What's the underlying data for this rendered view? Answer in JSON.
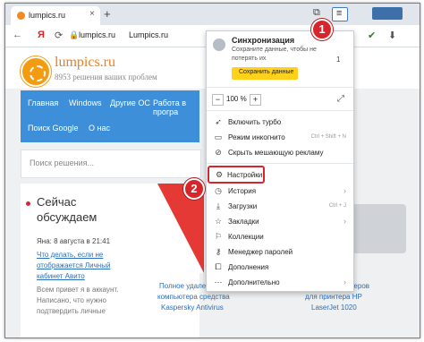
{
  "browser": {
    "tab_title": "lumpics.ru",
    "new_tab": "+",
    "tab_close": "×",
    "url_host": "lumpics.ru",
    "url_title": "Lumpics.ru",
    "yandex_letter": "Я"
  },
  "site": {
    "logo_title": "lumpics.ru",
    "logo_subtitle": "8953 решения ваших проблем",
    "nav": [
      "Главная",
      "Windows",
      "Другие ОС",
      "Работа в програ",
      "Поиск Google",
      "О нас"
    ],
    "search_placeholder": "Поиск решения...",
    "live_title_1": "Сейчас",
    "live_title_2": "обсуждаем",
    "comment_meta": "Яна: 8 августа в 21:41",
    "comment_link": [
      "Что делать, если не",
      "отображается Личный",
      "кабинет Авито"
    ],
    "comment_text": [
      "Всем привет я в аккаунт.",
      "Написано, что нужно",
      "подтвердить личные"
    ],
    "article_left": [
      "Полное удаление",
      "компьютера средства",
      "Kaspersky Antivirus"
    ],
    "article_right": [
      "Скачать драйверов",
      "для принтера HP",
      "LaserJet 1020"
    ]
  },
  "menu": {
    "sync_title": "Синхронизация",
    "sync_desc_1": "Сохраните данные, чтобы не",
    "sync_desc_2": "потерять их",
    "sync_count": "1",
    "save_button": "Сохранить данные",
    "zoom_minus": "−",
    "zoom_value": "100 %",
    "zoom_plus": "+",
    "items": [
      {
        "label": "Включить турбо",
        "shortcut": ""
      },
      {
        "label": "Режим инкогнито",
        "shortcut": "Ctrl + Shift + N"
      },
      {
        "label": "Скрыть мешающую рекламу",
        "shortcut": ""
      },
      {
        "label": "Настройки",
        "shortcut": ""
      },
      {
        "label": "История",
        "shortcut": ""
      },
      {
        "label": "Загрузки",
        "shortcut": "Ctrl + J"
      },
      {
        "label": "Закладки",
        "shortcut": ""
      },
      {
        "label": "Коллекции",
        "shortcut": ""
      },
      {
        "label": "Менеджер паролей",
        "shortcut": ""
      },
      {
        "label": "Дополнения",
        "shortcut": ""
      },
      {
        "label": "Дополнительно",
        "shortcut": ""
      }
    ]
  },
  "annotations": {
    "badge_1": "1",
    "badge_2": "2"
  },
  "colors": {
    "accent_red": "#d6262b",
    "nav_blue": "#3d8fd9",
    "yellow_button": "#ffd11a",
    "orange_logo": "#f39c12"
  }
}
